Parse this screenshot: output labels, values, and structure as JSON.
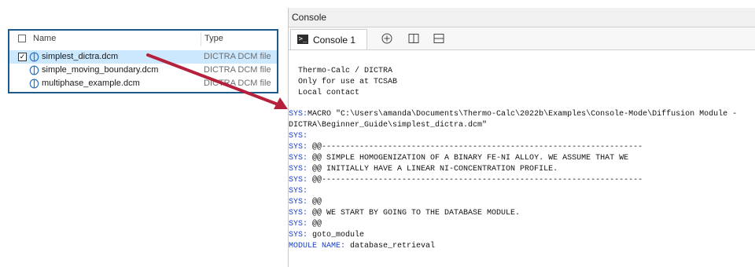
{
  "explorer": {
    "header": {
      "name": "Name",
      "type": "Type"
    },
    "files": [
      {
        "name": "simplest_dictra.dcm",
        "type": "DICTRA DCM file",
        "selected": true,
        "checked": true
      },
      {
        "name": "simple_moving_boundary.dcm",
        "type": "DICTRA DCM file",
        "selected": false,
        "checked": false
      },
      {
        "name": "multiphase_example.dcm",
        "type": "DICTRA DCM file",
        "selected": false,
        "checked": false
      }
    ],
    "check_mark": "✓"
  },
  "console": {
    "title": "Console",
    "tab_label": "Console 1",
    "tab_icon": ">_",
    "toolbar_icons": [
      "add-console-icon",
      "split-vertical-icon",
      "split-horizontal-icon"
    ],
    "banner": [
      "Thermo-Calc / DICTRA",
      "Only for use at TCSAB",
      "Local contact"
    ],
    "lines": [
      {
        "prefix": "SYS:",
        "text": "MACRO \"C:\\Users\\amanda\\Documents\\Thermo-Calc\\2022b\\Examples\\Console-Mode\\Diffusion Module -"
      },
      {
        "prefix": "",
        "text": "DICTRA\\Beginner_Guide\\simplest_dictra.dcm\""
      },
      {
        "prefix": "SYS:",
        "text": ""
      },
      {
        "prefix": "SYS:",
        "text": " @@--------------------------------------------------------------------"
      },
      {
        "prefix": "SYS:",
        "text": " @@ SIMPLE HOMOGENIZATION OF A BINARY FE-NI ALLOY. WE ASSUME THAT WE"
      },
      {
        "prefix": "SYS:",
        "text": " @@ INITIALLY HAVE A LINEAR NI-CONCENTRATION PROFILE."
      },
      {
        "prefix": "SYS:",
        "text": " @@--------------------------------------------------------------------"
      },
      {
        "prefix": "SYS:",
        "text": ""
      },
      {
        "prefix": "SYS:",
        "text": " @@"
      },
      {
        "prefix": "SYS:",
        "text": " @@ WE START BY GOING TO THE DATABASE MODULE."
      },
      {
        "prefix": "SYS:",
        "text": " @@"
      },
      {
        "prefix": "SYS:",
        "text": " goto_module"
      },
      {
        "prefix": "MODULE NAME:",
        "text": " database_retrieval"
      }
    ]
  },
  "colors": {
    "explorer_border": "#1d5a8b",
    "selection": "#cce8ff",
    "sys_prefix": "#1a3fc7",
    "arrow": "#b5213a"
  }
}
